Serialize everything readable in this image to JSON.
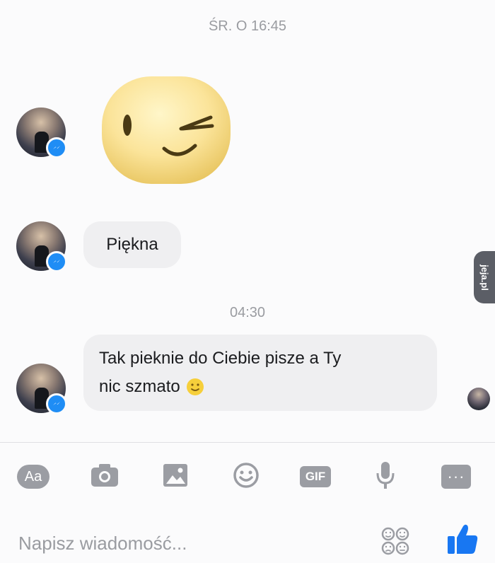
{
  "conversation": {
    "timestamp_1": "ŚR. O 16:45",
    "timestamp_2": "04:30",
    "messages": [
      {
        "type": "sticker",
        "sticker": "wink-emoji-sticker"
      },
      {
        "type": "text",
        "text": "Piękna"
      },
      {
        "type": "text",
        "line1": "Tak pieknie do Ciebie pisze a Ty",
        "line2": "nic szmato",
        "emoji": "slight-smile-emoji"
      }
    ]
  },
  "toolbar": {
    "text_format_label": "Aa",
    "gif_label": "GIF",
    "more_label": "···"
  },
  "composer": {
    "placeholder": "Napisz wiadomość..."
  },
  "watermark": {
    "text": "jeja.pl"
  },
  "colors": {
    "badge": "#1f8df5",
    "like": "#1877f2",
    "bubble": "#efeff1",
    "icon_gray": "#9b9da3"
  }
}
